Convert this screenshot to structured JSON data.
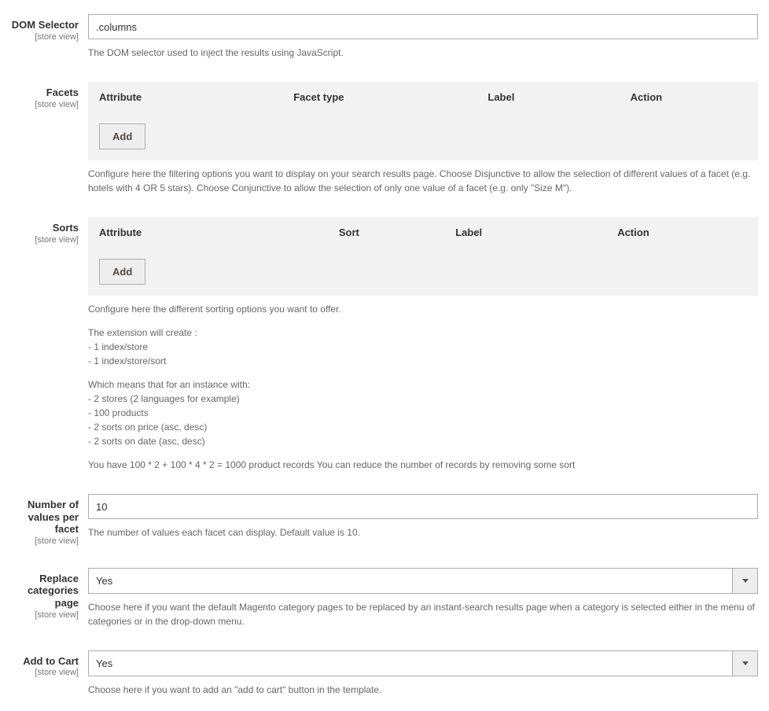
{
  "scope": "[store view]",
  "dom_selector": {
    "label": "DOM Selector",
    "value": ".columns",
    "help": "The DOM selector used to inject the results using JavaScript."
  },
  "facets": {
    "label": "Facets",
    "headers": {
      "attribute": "Attribute",
      "facet_type": "Facet type",
      "label": "Label",
      "action": "Action"
    },
    "add_label": "Add",
    "help": "Configure here the filtering options you want to display on your search results page. Choose Disjunctive to allow the selection of different values of a facet (e.g. hotels with 4 OR 5 stars). Choose Conjunctive to allow the selection of only one value of a facet (e.g. only \"Size M\")."
  },
  "sorts": {
    "label": "Sorts",
    "headers": {
      "attribute": "Attribute",
      "sort": "Sort",
      "label": "Label",
      "action": "Action"
    },
    "add_label": "Add",
    "help_lines": [
      "Configure here the different sorting options you want to offer.",
      "The extension will create :",
      "- 1 index/store",
      "- 1 index/store/sort",
      "Which means that for an instance with:",
      "- 2 stores (2 languages for example)",
      "- 100 products",
      "- 2 sorts on price (asc, desc)",
      "- 2 sorts on date (asc, desc)",
      "You have 100 * 2 + 100 * 4 * 2 = 1000 product records You can reduce the number of records by removing some sort"
    ]
  },
  "num_values": {
    "label": "Number of values per facet",
    "value": "10",
    "help": "The number of values each facet can display. Default value is 10."
  },
  "replace_categories": {
    "label": "Replace categories page",
    "value": "Yes",
    "help": "Choose here if you want the default Magento category pages to be replaced by an instant-search results page when a category is selected either in the menu of categories or in the drop-down menu."
  },
  "add_to_cart": {
    "label": "Add to Cart",
    "value": "Yes",
    "help": "Choose here if you want to add an \"add to cart\" button in the template."
  }
}
